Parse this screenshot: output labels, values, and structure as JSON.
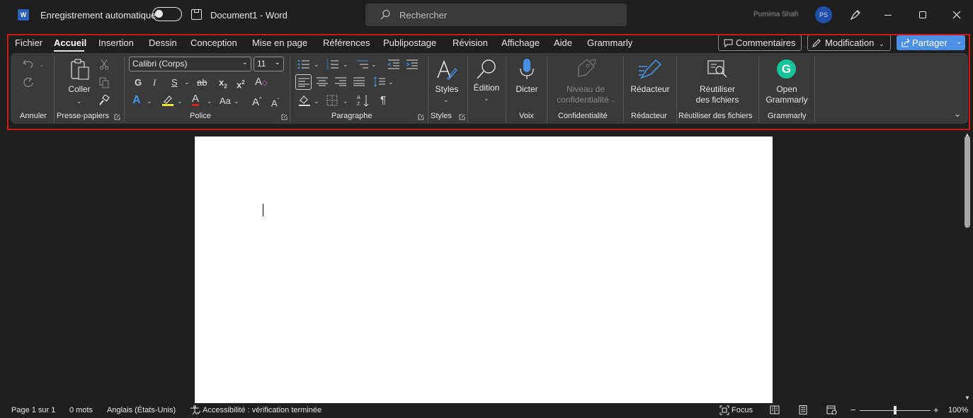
{
  "titlebar": {
    "autosave_label": "Enregistrement automatique",
    "doc_title": "Document1  -  Word",
    "search_placeholder": "Rechercher",
    "user_name": "Purnima Shah",
    "avatar_initials": "PS"
  },
  "menu": {
    "items": [
      "Fichier",
      "Accueil",
      "Insertion",
      "Dessin",
      "Conception",
      "Mise en page",
      "Références",
      "Publipostage",
      "Révision",
      "Affichage",
      "Aide",
      "Grammarly"
    ],
    "active": "Accueil"
  },
  "header_buttons": {
    "comments": "Commentaires",
    "edit_mode": "Modification",
    "share": "Partager"
  },
  "ribbon": {
    "font_name": "Calibri (Corps)",
    "font_size": "11",
    "paste_label": "Coller",
    "styles_label": "Styles",
    "edit_label": "Édition",
    "dictate_label": "Dicter",
    "sensitivity_line1": "Niveau de",
    "sensitivity_line2": "confidentialité",
    "editor_label": "Rédacteur",
    "reuse_line1": "Réutiliser",
    "reuse_line2": "des fichiers",
    "grammarly_line1": "Open",
    "grammarly_line2": "Grammarly",
    "groups": {
      "undo": "Annuler",
      "clipboard": "Presse-papiers",
      "font": "Police",
      "paragraph": "Paragraphe",
      "styles": "Styles",
      "voice": "Voix",
      "sensitivity": "Confidentialité",
      "editor": "Rédacteur",
      "reuse": "Réutiliser des fichiers",
      "grammarly": "Grammarly"
    }
  },
  "status": {
    "page": "Page 1 sur 1",
    "words": "0 mots",
    "language": "Anglais (États-Unis)",
    "accessibility": "Accessibilité : vérification terminée",
    "focus": "Focus",
    "zoom": "100%",
    "zoom_minus": "−",
    "zoom_plus": "+"
  },
  "colors": {
    "accent_share": "#4c8fe6",
    "highlight_red": "#d01919",
    "grammarly_green": "#15c39a",
    "dictate_blue": "#4a90e2"
  }
}
